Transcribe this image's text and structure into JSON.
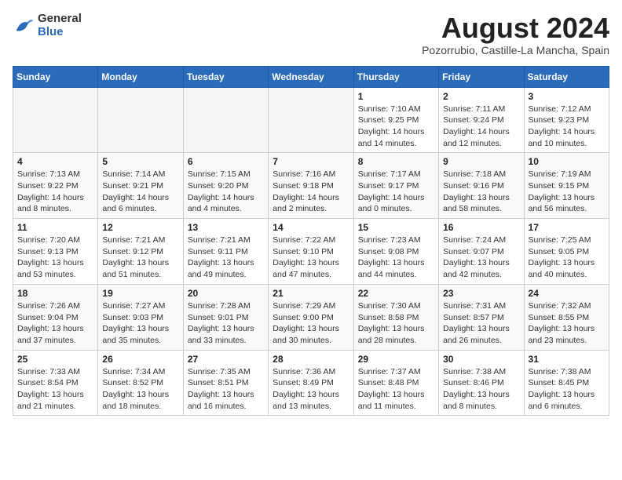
{
  "header": {
    "logo_general": "General",
    "logo_blue": "Blue",
    "month_year": "August 2024",
    "location": "Pozorrubio, Castille-La Mancha, Spain"
  },
  "calendar": {
    "days_of_week": [
      "Sunday",
      "Monday",
      "Tuesday",
      "Wednesday",
      "Thursday",
      "Friday",
      "Saturday"
    ],
    "weeks": [
      [
        {
          "day": "",
          "info": ""
        },
        {
          "day": "",
          "info": ""
        },
        {
          "day": "",
          "info": ""
        },
        {
          "day": "",
          "info": ""
        },
        {
          "day": "1",
          "info": "Sunrise: 7:10 AM\nSunset: 9:25 PM\nDaylight: 14 hours and 14 minutes."
        },
        {
          "day": "2",
          "info": "Sunrise: 7:11 AM\nSunset: 9:24 PM\nDaylight: 14 hours and 12 minutes."
        },
        {
          "day": "3",
          "info": "Sunrise: 7:12 AM\nSunset: 9:23 PM\nDaylight: 14 hours and 10 minutes."
        }
      ],
      [
        {
          "day": "4",
          "info": "Sunrise: 7:13 AM\nSunset: 9:22 PM\nDaylight: 14 hours and 8 minutes."
        },
        {
          "day": "5",
          "info": "Sunrise: 7:14 AM\nSunset: 9:21 PM\nDaylight: 14 hours and 6 minutes."
        },
        {
          "day": "6",
          "info": "Sunrise: 7:15 AM\nSunset: 9:20 PM\nDaylight: 14 hours and 4 minutes."
        },
        {
          "day": "7",
          "info": "Sunrise: 7:16 AM\nSunset: 9:18 PM\nDaylight: 14 hours and 2 minutes."
        },
        {
          "day": "8",
          "info": "Sunrise: 7:17 AM\nSunset: 9:17 PM\nDaylight: 14 hours and 0 minutes."
        },
        {
          "day": "9",
          "info": "Sunrise: 7:18 AM\nSunset: 9:16 PM\nDaylight: 13 hours and 58 minutes."
        },
        {
          "day": "10",
          "info": "Sunrise: 7:19 AM\nSunset: 9:15 PM\nDaylight: 13 hours and 56 minutes."
        }
      ],
      [
        {
          "day": "11",
          "info": "Sunrise: 7:20 AM\nSunset: 9:13 PM\nDaylight: 13 hours and 53 minutes."
        },
        {
          "day": "12",
          "info": "Sunrise: 7:21 AM\nSunset: 9:12 PM\nDaylight: 13 hours and 51 minutes."
        },
        {
          "day": "13",
          "info": "Sunrise: 7:21 AM\nSunset: 9:11 PM\nDaylight: 13 hours and 49 minutes."
        },
        {
          "day": "14",
          "info": "Sunrise: 7:22 AM\nSunset: 9:10 PM\nDaylight: 13 hours and 47 minutes."
        },
        {
          "day": "15",
          "info": "Sunrise: 7:23 AM\nSunset: 9:08 PM\nDaylight: 13 hours and 44 minutes."
        },
        {
          "day": "16",
          "info": "Sunrise: 7:24 AM\nSunset: 9:07 PM\nDaylight: 13 hours and 42 minutes."
        },
        {
          "day": "17",
          "info": "Sunrise: 7:25 AM\nSunset: 9:05 PM\nDaylight: 13 hours and 40 minutes."
        }
      ],
      [
        {
          "day": "18",
          "info": "Sunrise: 7:26 AM\nSunset: 9:04 PM\nDaylight: 13 hours and 37 minutes."
        },
        {
          "day": "19",
          "info": "Sunrise: 7:27 AM\nSunset: 9:03 PM\nDaylight: 13 hours and 35 minutes."
        },
        {
          "day": "20",
          "info": "Sunrise: 7:28 AM\nSunset: 9:01 PM\nDaylight: 13 hours and 33 minutes."
        },
        {
          "day": "21",
          "info": "Sunrise: 7:29 AM\nSunset: 9:00 PM\nDaylight: 13 hours and 30 minutes."
        },
        {
          "day": "22",
          "info": "Sunrise: 7:30 AM\nSunset: 8:58 PM\nDaylight: 13 hours and 28 minutes."
        },
        {
          "day": "23",
          "info": "Sunrise: 7:31 AM\nSunset: 8:57 PM\nDaylight: 13 hours and 26 minutes."
        },
        {
          "day": "24",
          "info": "Sunrise: 7:32 AM\nSunset: 8:55 PM\nDaylight: 13 hours and 23 minutes."
        }
      ],
      [
        {
          "day": "25",
          "info": "Sunrise: 7:33 AM\nSunset: 8:54 PM\nDaylight: 13 hours and 21 minutes."
        },
        {
          "day": "26",
          "info": "Sunrise: 7:34 AM\nSunset: 8:52 PM\nDaylight: 13 hours and 18 minutes."
        },
        {
          "day": "27",
          "info": "Sunrise: 7:35 AM\nSunset: 8:51 PM\nDaylight: 13 hours and 16 minutes."
        },
        {
          "day": "28",
          "info": "Sunrise: 7:36 AM\nSunset: 8:49 PM\nDaylight: 13 hours and 13 minutes."
        },
        {
          "day": "29",
          "info": "Sunrise: 7:37 AM\nSunset: 8:48 PM\nDaylight: 13 hours and 11 minutes."
        },
        {
          "day": "30",
          "info": "Sunrise: 7:38 AM\nSunset: 8:46 PM\nDaylight: 13 hours and 8 minutes."
        },
        {
          "day": "31",
          "info": "Sunrise: 7:38 AM\nSunset: 8:45 PM\nDaylight: 13 hours and 6 minutes."
        }
      ]
    ]
  }
}
